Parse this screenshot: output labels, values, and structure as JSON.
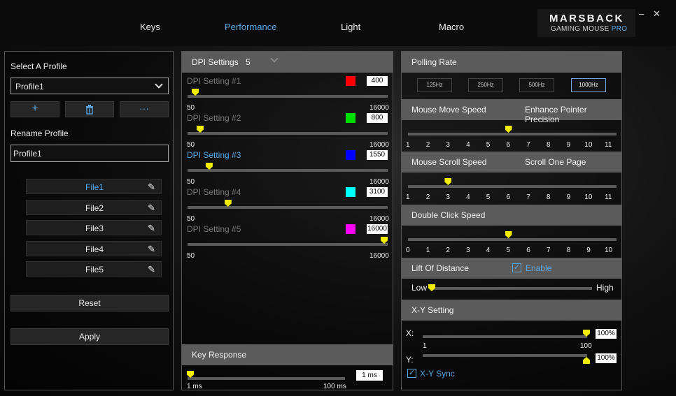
{
  "tabs": [
    "Keys",
    "Performance",
    "Light",
    "Macro"
  ],
  "brand": {
    "line1": "MARSBACK",
    "line2": "GAMING MOUSE",
    "line2_accent": "PRO"
  },
  "window": {
    "minimize": "–",
    "close": "✕"
  },
  "profile": {
    "select_label": "Select A Profile",
    "selected": "Profile1",
    "rename_label": "Rename Profile",
    "rename_value": "Profile1",
    "files": [
      "File1",
      "File2",
      "File3",
      "File4",
      "File5"
    ],
    "active_file": "File1",
    "reset": "Reset",
    "apply": "Apply",
    "more_label": "···"
  },
  "dpi": {
    "title": "DPI Settings",
    "count": "5",
    "min": "50",
    "max": "16000",
    "active_index": 2,
    "settings": [
      {
        "label": "DPI Setting #1",
        "value": "400",
        "color": "#ff0000"
      },
      {
        "label": "DPI Setting #2",
        "value": "800",
        "color": "#00e000"
      },
      {
        "label": "DPI Setting #3",
        "value": "1550",
        "color": "#0000ff"
      },
      {
        "label": "DPI Setting #4",
        "value": "3100",
        "color": "#00ffff"
      },
      {
        "label": "DPI Setting #5",
        "value": "16000",
        "color": "#ff00ff"
      }
    ]
  },
  "key_response": {
    "title": "Key Response",
    "value": "1 ms",
    "min": "1 ms",
    "max": "100 ms",
    "level": 0.0
  },
  "polling": {
    "title": "Polling Rate",
    "options": [
      "125Hz",
      "250Hz",
      "500Hz",
      "1000Hz"
    ],
    "selected": "1000Hz"
  },
  "move_speed": {
    "title": "Mouse Move Speed",
    "extra": "Enhance Pointer Precision",
    "ticks": [
      "1",
      "2",
      "3",
      "4",
      "5",
      "6",
      "7",
      "8",
      "9",
      "10",
      "11"
    ],
    "value": 6
  },
  "scroll_speed": {
    "title": "Mouse Scroll Speed",
    "extra": "Scroll One Page",
    "ticks": [
      "1",
      "2",
      "3",
      "4",
      "5",
      "6",
      "7",
      "8",
      "9",
      "10",
      "11"
    ],
    "value": 3
  },
  "double_click": {
    "title": "Double Click Speed",
    "ticks": [
      "0",
      "1",
      "2",
      "3",
      "4",
      "5",
      "6",
      "7",
      "8",
      "9",
      "10"
    ],
    "value": 5
  },
  "lod": {
    "title": "Lift Of Distance",
    "enable_label": "Enable",
    "enabled": true,
    "low": "Low",
    "high": "High",
    "level": 0.0
  },
  "xy": {
    "title": "X-Y Setting",
    "x_label": "X:",
    "y_label": "Y:",
    "x_value": "100%",
    "y_value": "100%",
    "min": "1",
    "max": "100",
    "sync_label": "X-Y Sync",
    "sync": true
  },
  "colors": {
    "accent": "#5aa8e6",
    "thumb": "#f2ee00",
    "header": "#5b5b5b"
  }
}
